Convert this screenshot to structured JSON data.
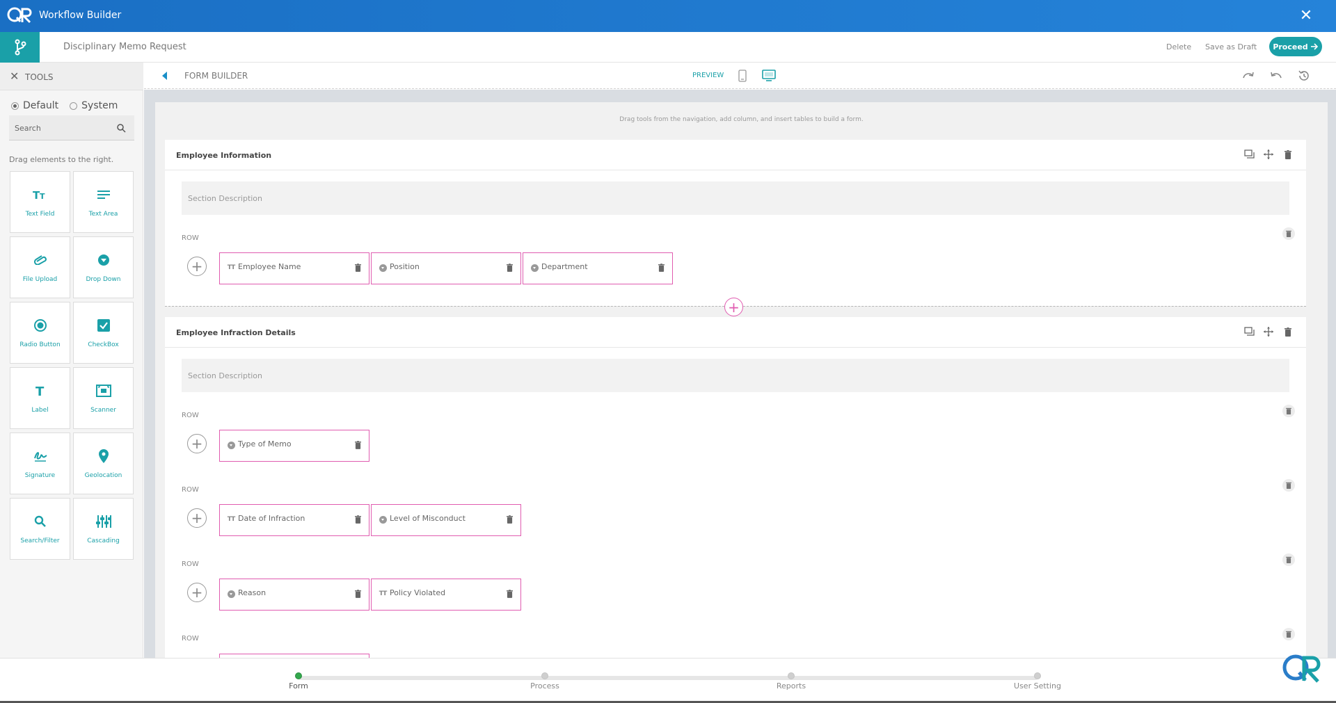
{
  "app": {
    "title": "Workflow Builder",
    "close_icon": "close-icon"
  },
  "header": {
    "form_name": "Disciplinary Memo Request",
    "delete_label": "Delete",
    "draft_label": "Save as Draft",
    "proceed_label": "Proceed"
  },
  "sidebar": {
    "title": "TOOLS",
    "radio_default": "Default",
    "radio_system": "System",
    "selected_radio": "Default",
    "search_placeholder": "Search",
    "hint": "Drag elements to the right.",
    "tools": [
      {
        "label": "Text Field",
        "icon": "text-field-icon"
      },
      {
        "label": "Text Area",
        "icon": "text-area-icon"
      },
      {
        "label": "File Upload",
        "icon": "paperclip-icon"
      },
      {
        "label": "Drop Down",
        "icon": "dropdown-icon"
      },
      {
        "label": "Radio Button",
        "icon": "radio-button-icon"
      },
      {
        "label": "CheckBox",
        "icon": "checkbox-icon"
      },
      {
        "label": "Label",
        "icon": "label-icon"
      },
      {
        "label": "Scanner",
        "icon": "scanner-icon"
      },
      {
        "label": "Signature",
        "icon": "signature-icon"
      },
      {
        "label": "Geolocation",
        "icon": "location-pin-icon"
      },
      {
        "label": "Search/Filter",
        "icon": "search-filter-icon"
      },
      {
        "label": "Cascading",
        "icon": "cascading-icon"
      }
    ]
  },
  "builder": {
    "title": "FORM BUILDER",
    "preview_label": "PREVIEW",
    "active_device": "desktop",
    "hint": "Drag tools from the navigation, add column, and insert tables to build a form."
  },
  "sections": [
    {
      "title": "Employee Information",
      "description_placeholder": "Section Description",
      "rows": [
        {
          "label": "ROW",
          "fields": [
            {
              "label": "Employee Name",
              "type": "text"
            },
            {
              "label": "Position",
              "type": "dropdown"
            },
            {
              "label": "Department",
              "type": "dropdown"
            }
          ]
        }
      ]
    },
    {
      "title": "Employee Infraction Details",
      "description_placeholder": "Section Description",
      "rows": [
        {
          "label": "ROW",
          "fields": [
            {
              "label": "Type of Memo",
              "type": "dropdown"
            }
          ]
        },
        {
          "label": "ROW",
          "fields": [
            {
              "label": "Date of Infraction",
              "type": "text"
            },
            {
              "label": "Level of Misconduct",
              "type": "dropdown"
            }
          ]
        },
        {
          "label": "ROW",
          "fields": [
            {
              "label": "Reason",
              "type": "dropdown"
            },
            {
              "label": "Policy Violated",
              "type": "text"
            }
          ]
        },
        {
          "label": "ROW",
          "fields": []
        }
      ]
    }
  ],
  "stepper": {
    "steps": [
      "Form",
      "Process",
      "Reports",
      "User Setting"
    ],
    "active": "Form"
  },
  "colors": {
    "titlebar": "#1a6fc4",
    "accent_teal": "#1aa0a8",
    "field_border": "#e05bb0",
    "active_step": "#33a84d"
  }
}
